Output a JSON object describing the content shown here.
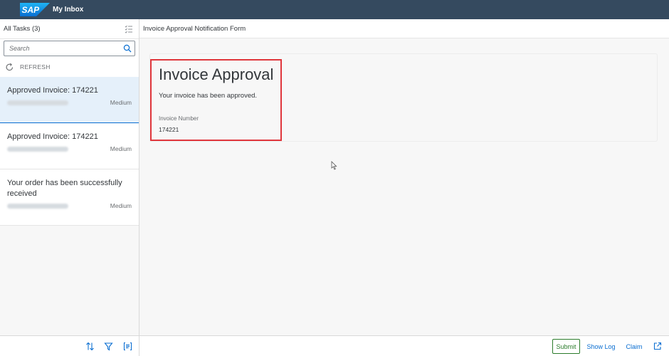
{
  "shell": {
    "logo_text": "SAP",
    "title": "My Inbox",
    "bar_color": "#354a5f"
  },
  "master": {
    "title": "All Tasks (3)",
    "search_placeholder": "Search",
    "refresh_label": "REFRESH",
    "tasks": [
      {
        "title": "Approved Invoice: 174221",
        "priority": "Medium",
        "selected": true
      },
      {
        "title": "Approved Invoice: 174221",
        "priority": "Medium",
        "selected": false
      },
      {
        "title": "Your order has been successfully received",
        "priority": "Medium",
        "selected": false
      }
    ]
  },
  "detail": {
    "title": "Invoice Approval Notification Form",
    "form": {
      "heading": "Invoice Approval",
      "message": "Your invoice has been approved.",
      "field_label": "Invoice Number",
      "field_value": "174221"
    },
    "footer": {
      "submit_label": "Submit",
      "showlog_label": "Show Log",
      "claim_label": "Claim"
    }
  },
  "colors": {
    "accent": "#0a6ed1",
    "submit": "#2b7c2b",
    "highlight": "#e0363c",
    "selected_bg": "#e5f0fa"
  },
  "icons": [
    "multi-select-icon",
    "search-icon",
    "refresh-icon",
    "sort-icon",
    "filter-icon",
    "group-icon",
    "open-in-new-window-icon",
    "cursor-icon"
  ]
}
